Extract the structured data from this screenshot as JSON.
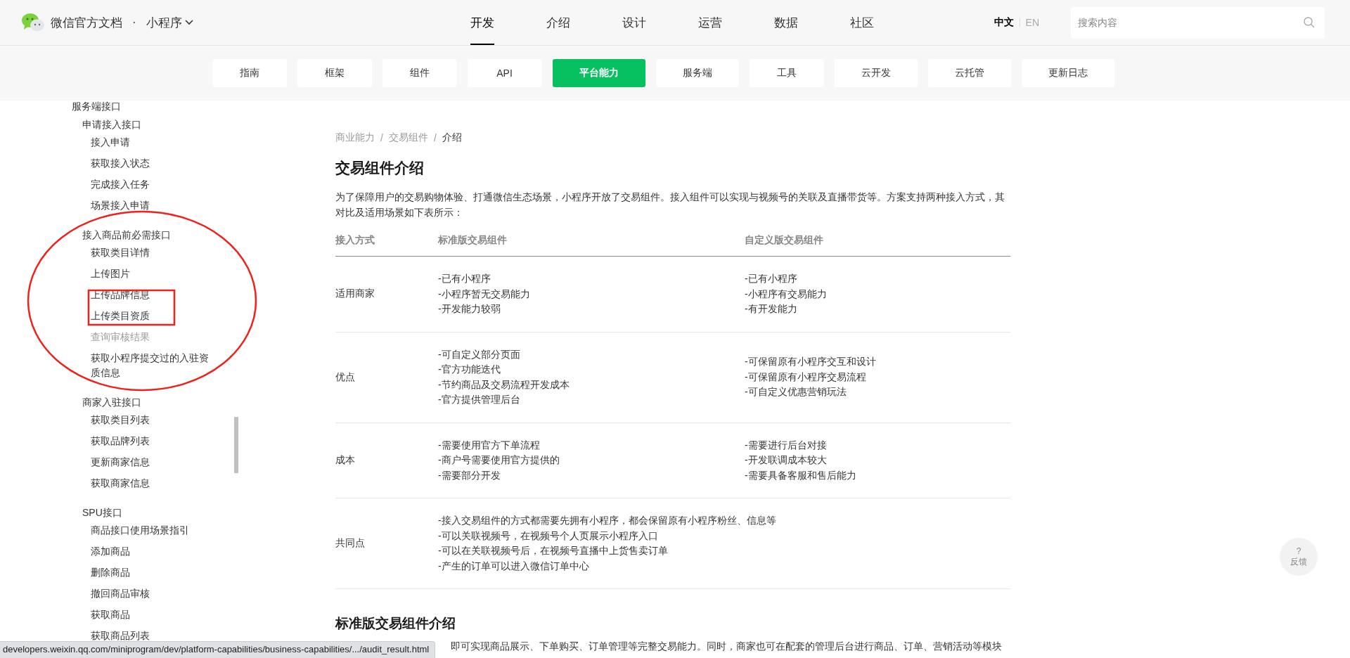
{
  "header": {
    "brand": "微信官方文档",
    "dot": "·",
    "product": "小程序",
    "nav": [
      {
        "label": "开发",
        "selected": true
      },
      {
        "label": "介绍",
        "selected": false
      },
      {
        "label": "设计",
        "selected": false
      },
      {
        "label": "运营",
        "selected": false
      },
      {
        "label": "数据",
        "selected": false
      },
      {
        "label": "社区",
        "selected": false
      }
    ],
    "languages": [
      {
        "label": "中文",
        "selected": true
      },
      {
        "label": "EN",
        "selected": false
      }
    ],
    "search": {
      "placeholder": "搜索内容"
    }
  },
  "subnav": [
    {
      "label": "指南",
      "selected": false
    },
    {
      "label": "框架",
      "selected": false
    },
    {
      "label": "组件",
      "selected": false
    },
    {
      "label": "API",
      "selected": false
    },
    {
      "label": "平台能力",
      "selected": true
    },
    {
      "label": "服务端",
      "selected": false
    },
    {
      "label": "工具",
      "selected": false
    },
    {
      "label": "云开发",
      "selected": false
    },
    {
      "label": "云托管",
      "selected": false
    },
    {
      "label": "更新日志",
      "selected": false
    }
  ],
  "sidebar": {
    "items": [
      {
        "label": "服务端接口",
        "children": [
          {
            "label": "申请接入接口",
            "children": [
              {
                "label": "接入申请",
                "hovered": false
              },
              {
                "label": "获取接入状态",
                "hovered": false
              },
              {
                "label": "完成接入任务",
                "hovered": false
              },
              {
                "label": "场景接入申请",
                "hovered": false
              }
            ]
          },
          {
            "label": "接入商品前必需接口",
            "children": [
              {
                "label": "获取类目详情",
                "hovered": false
              },
              {
                "label": "上传图片",
                "hovered": false
              },
              {
                "label": "上传品牌信息",
                "hovered": false
              },
              {
                "label": "上传类目资质",
                "hovered": false
              },
              {
                "label": "查询审核结果",
                "hovered": true
              },
              {
                "label": "获取小程序提交过的入驻资质信息",
                "hovered": false
              }
            ]
          },
          {
            "label": "商家入驻接口",
            "children": [
              {
                "label": "获取类目列表",
                "hovered": false
              },
              {
                "label": "获取品牌列表",
                "hovered": false
              },
              {
                "label": "更新商家信息",
                "hovered": false
              },
              {
                "label": "获取商家信息",
                "hovered": false
              }
            ]
          },
          {
            "label": "SPU接口",
            "children": [
              {
                "label": "商品接口使用场景指引",
                "hovered": false
              },
              {
                "label": "添加商品",
                "hovered": false
              },
              {
                "label": "删除商品",
                "hovered": false
              },
              {
                "label": "撤回商品审核",
                "hovered": false
              },
              {
                "label": "获取商品",
                "hovered": false
              },
              {
                "label": "获取商品列表",
                "hovered": false
              }
            ]
          }
        ]
      }
    ]
  },
  "annotations": [
    {
      "kind": "ellipse"
    },
    {
      "kind": "rectangle"
    }
  ],
  "breadcrumb": {
    "separator": "/",
    "items": [
      "商业能力",
      "交易组件",
      "介绍"
    ]
  },
  "title": "交易组件介绍",
  "intro": "为了保障用户的交易购物体验、打通微信生态场景，小程序开放了交易组件。接入组件可以实现与视频号的关联及直播带货等。方案支持两种接入方式，其对比及适用场景如下表所示：",
  "table": {
    "columns": [
      "接入方式",
      "标准版交易组件",
      "自定义版交易组件"
    ],
    "rows": [
      {
        "label": "适用商家",
        "standard": [
          "-已有小程序",
          "-小程序暂无交易能力",
          "-开发能力较弱"
        ],
        "custom": [
          "-已有小程序",
          "-小程序有交易能力",
          "-有开发能力"
        ]
      },
      {
        "label": "优点",
        "standard": [
          "-可自定义部分页面",
          "-官方功能迭代",
          "-节约商品及交易流程开发成本",
          "-官方提供管理后台"
        ],
        "custom": [
          "-可保留原有小程序交互和设计",
          "-可保留原有小程序交易流程",
          "-可自定义优惠营销玩法"
        ]
      },
      {
        "label": "成本",
        "standard": [
          "-需要使用官方下单流程",
          "-商户号需要使用官方提供的",
          "-需要部分开发"
        ],
        "custom": [
          "-需要进行后台对接",
          "-开发联调成本较大",
          "-需要具备客服和售后能力"
        ]
      },
      {
        "label": "共同点",
        "standard": [
          "-接入交易组件的方式都需要先拥有小程序，都会保留原有小程序粉丝、信息等",
          "-可以关联视频号，在视频号个人页展示小程序入口",
          "-可以在关联视频号后，在视频号直播中上货售卖订单",
          "-产生的订单可以进入微信订单中心"
        ]
      }
    ]
  },
  "section2": {
    "title": "标准版交易组件介绍",
    "text": "即可实现商品展示、下单购买、订单管理等完整交易能力。同时，商家也可在配套的管理后台进行商品、订单、营销活动等模块"
  },
  "feedback": {
    "mark": "?",
    "label": "反馈"
  },
  "status_url": "developers.weixin.qq.com/miniprogram/dev/platform-capabilities/business-capabilities/.../audit_result.html"
}
